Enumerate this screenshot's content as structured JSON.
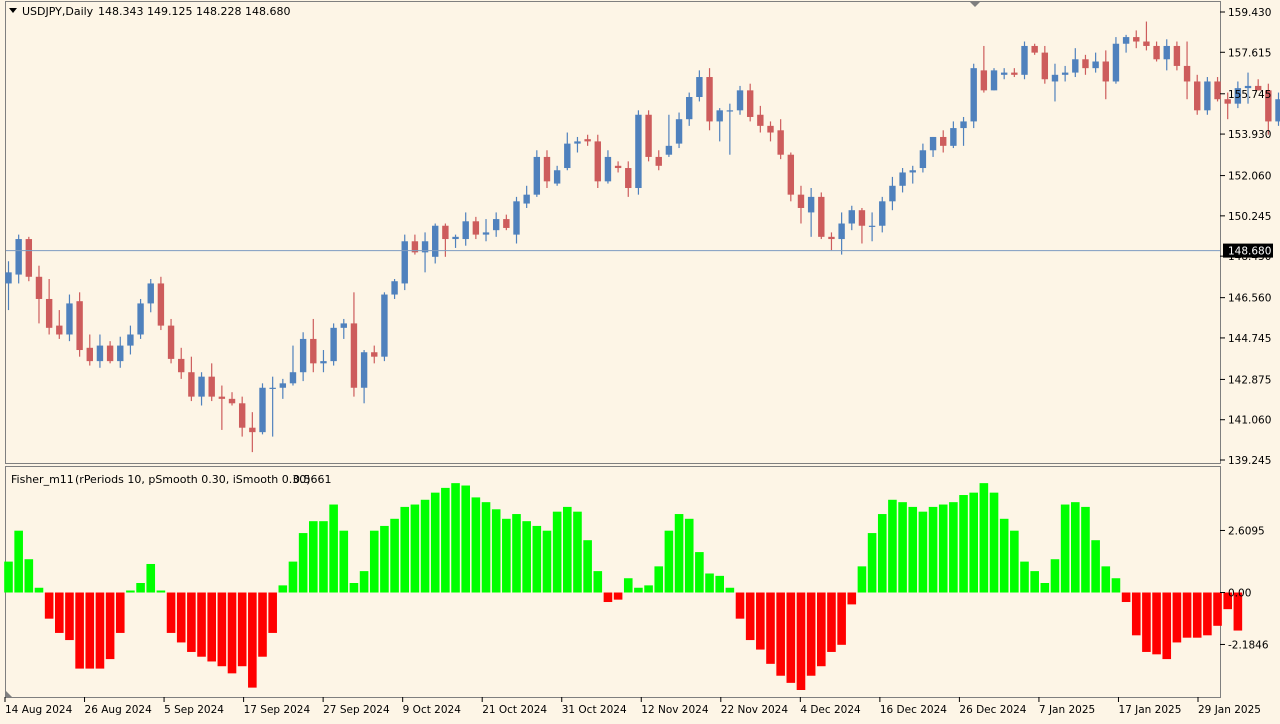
{
  "colors": {
    "background": "#fdf5e6",
    "frame": "#7f7f7f",
    "bull": "#4f81bd",
    "bear": "#cd5c5c",
    "hist_pos": "#00ff00",
    "hist_neg": "#ff0000",
    "price_line": "#7d9bc1",
    "text": "#000000"
  },
  "symbol_info": {
    "symbol_tf": "USDJPY,Daily",
    "ohlc": "148.343 149.125 148.228 148.680"
  },
  "indicator_info": {
    "name": "Fisher_m11",
    "params": "(rPeriods 10, pSmooth 0.30, iSmooth 0.30)",
    "value": "0.5661"
  },
  "price_labels": [
    "159.430",
    "157.615",
    "155.745",
    "153.930",
    "152.060",
    "150.245",
    "148.430",
    "146.560",
    "144.745",
    "142.875",
    "141.060",
    "139.245"
  ],
  "indicator_labels": [
    "2.6095",
    "0.00",
    "-2.1846"
  ],
  "current_price_label": "148.680",
  "date_labels": [
    "14 Aug 2024",
    "26 Aug 2024",
    "5 Sep 2024",
    "17 Sep 2024",
    "27 Sep 2024",
    "9 Oct 2024",
    "21 Oct 2024",
    "31 Oct 2024",
    "12 Nov 2024",
    "22 Nov 2024",
    "4 Dec 2024",
    "16 Dec 2024",
    "26 Dec 2024",
    "7 Jan 2025",
    "17 Jan 2025",
    "29 Jan 2025"
  ],
  "chart_data": [
    {
      "type": "candlestick",
      "title": "USDJPY,Daily",
      "ylim": [
        139.245,
        159.43
      ],
      "current_price": 148.68,
      "candles": [
        {
          "o": 147.2,
          "h": 148.2,
          "l": 146.0,
          "c": 147.7
        },
        {
          "o": 147.6,
          "h": 149.4,
          "l": 147.2,
          "c": 149.2
        },
        {
          "o": 149.2,
          "h": 149.3,
          "l": 147.3,
          "c": 147.5
        },
        {
          "o": 147.5,
          "h": 148.0,
          "l": 145.4,
          "c": 146.5
        },
        {
          "o": 146.5,
          "h": 147.4,
          "l": 144.9,
          "c": 145.2
        },
        {
          "o": 145.3,
          "h": 146.0,
          "l": 144.7,
          "c": 144.9
        },
        {
          "o": 144.9,
          "h": 146.7,
          "l": 144.6,
          "c": 146.3
        },
        {
          "o": 146.4,
          "h": 146.8,
          "l": 143.9,
          "c": 144.2
        },
        {
          "o": 144.3,
          "h": 144.9,
          "l": 143.5,
          "c": 143.7
        },
        {
          "o": 143.7,
          "h": 144.9,
          "l": 143.4,
          "c": 144.4
        },
        {
          "o": 144.4,
          "h": 144.6,
          "l": 143.6,
          "c": 143.7
        },
        {
          "o": 143.7,
          "h": 144.8,
          "l": 143.4,
          "c": 144.4
        },
        {
          "o": 144.4,
          "h": 145.3,
          "l": 144.0,
          "c": 144.9
        },
        {
          "o": 144.9,
          "h": 146.5,
          "l": 144.7,
          "c": 146.3
        },
        {
          "o": 146.3,
          "h": 147.4,
          "l": 145.9,
          "c": 147.2
        },
        {
          "o": 147.2,
          "h": 147.5,
          "l": 145.1,
          "c": 145.3
        },
        {
          "o": 145.3,
          "h": 145.6,
          "l": 143.6,
          "c": 143.8
        },
        {
          "o": 143.8,
          "h": 144.3,
          "l": 142.9,
          "c": 143.2
        },
        {
          "o": 143.2,
          "h": 143.9,
          "l": 141.9,
          "c": 142.1
        },
        {
          "o": 142.1,
          "h": 143.2,
          "l": 141.7,
          "c": 143.0
        },
        {
          "o": 143.0,
          "h": 143.6,
          "l": 141.9,
          "c": 142.1
        },
        {
          "o": 142.1,
          "h": 142.6,
          "l": 140.6,
          "c": 142.0
        },
        {
          "o": 142.0,
          "h": 142.3,
          "l": 141.7,
          "c": 141.8
        },
        {
          "o": 141.8,
          "h": 142.1,
          "l": 140.3,
          "c": 140.7
        },
        {
          "o": 140.7,
          "h": 141.4,
          "l": 139.6,
          "c": 140.5
        },
        {
          "o": 140.5,
          "h": 142.7,
          "l": 140.4,
          "c": 142.5
        },
        {
          "o": 142.5,
          "h": 143.0,
          "l": 140.3,
          "c": 142.5
        },
        {
          "o": 142.5,
          "h": 142.9,
          "l": 142.0,
          "c": 142.7
        },
        {
          "o": 142.7,
          "h": 144.4,
          "l": 142.6,
          "c": 143.2
        },
        {
          "o": 143.2,
          "h": 145.0,
          "l": 142.8,
          "c": 144.7
        },
        {
          "o": 144.7,
          "h": 145.6,
          "l": 143.2,
          "c": 143.6
        },
        {
          "o": 143.6,
          "h": 144.2,
          "l": 143.2,
          "c": 143.7
        },
        {
          "o": 143.7,
          "h": 145.4,
          "l": 143.5,
          "c": 145.2
        },
        {
          "o": 145.2,
          "h": 145.6,
          "l": 144.7,
          "c": 145.4
        },
        {
          "o": 145.4,
          "h": 146.8,
          "l": 142.1,
          "c": 142.5
        },
        {
          "o": 142.5,
          "h": 144.2,
          "l": 141.8,
          "c": 144.1
        },
        {
          "o": 144.1,
          "h": 144.4,
          "l": 143.6,
          "c": 143.9
        },
        {
          "o": 143.9,
          "h": 146.8,
          "l": 143.7,
          "c": 146.7
        },
        {
          "o": 146.7,
          "h": 147.4,
          "l": 146.5,
          "c": 147.3
        },
        {
          "o": 147.2,
          "h": 149.4,
          "l": 146.9,
          "c": 149.1
        },
        {
          "o": 149.1,
          "h": 149.4,
          "l": 148.5,
          "c": 148.6
        },
        {
          "o": 148.6,
          "h": 149.5,
          "l": 147.7,
          "c": 149.1
        },
        {
          "o": 148.4,
          "h": 149.9,
          "l": 148.1,
          "c": 149.8
        },
        {
          "o": 149.8,
          "h": 149.9,
          "l": 148.4,
          "c": 149.2
        },
        {
          "o": 149.2,
          "h": 149.4,
          "l": 148.8,
          "c": 149.3
        },
        {
          "o": 149.2,
          "h": 150.4,
          "l": 148.9,
          "c": 150.0
        },
        {
          "o": 150.0,
          "h": 150.2,
          "l": 149.2,
          "c": 149.4
        },
        {
          "o": 149.4,
          "h": 150.1,
          "l": 149.1,
          "c": 149.5
        },
        {
          "o": 149.6,
          "h": 150.4,
          "l": 149.3,
          "c": 150.1
        },
        {
          "o": 150.1,
          "h": 150.3,
          "l": 149.6,
          "c": 149.7
        },
        {
          "o": 149.4,
          "h": 151.1,
          "l": 149.0,
          "c": 150.9
        },
        {
          "o": 150.8,
          "h": 151.6,
          "l": 150.6,
          "c": 151.2
        },
        {
          "o": 151.2,
          "h": 153.2,
          "l": 151.1,
          "c": 152.9
        },
        {
          "o": 152.9,
          "h": 153.2,
          "l": 151.5,
          "c": 151.8
        },
        {
          "o": 151.7,
          "h": 152.5,
          "l": 151.6,
          "c": 152.3
        },
        {
          "o": 152.4,
          "h": 154.0,
          "l": 152.3,
          "c": 153.5
        },
        {
          "o": 153.5,
          "h": 153.8,
          "l": 153.1,
          "c": 153.6
        },
        {
          "o": 153.7,
          "h": 153.9,
          "l": 153.4,
          "c": 153.6
        },
        {
          "o": 153.6,
          "h": 153.9,
          "l": 151.5,
          "c": 151.8
        },
        {
          "o": 151.8,
          "h": 153.2,
          "l": 151.7,
          "c": 152.9
        },
        {
          "o": 152.5,
          "h": 152.7,
          "l": 152.2,
          "c": 152.4
        },
        {
          "o": 152.4,
          "h": 152.7,
          "l": 151.1,
          "c": 151.5
        },
        {
          "o": 151.5,
          "h": 155.0,
          "l": 151.2,
          "c": 154.8
        },
        {
          "o": 154.8,
          "h": 155.0,
          "l": 152.7,
          "c": 152.9
        },
        {
          "o": 152.9,
          "h": 153.2,
          "l": 152.3,
          "c": 152.5
        },
        {
          "o": 153.0,
          "h": 154.8,
          "l": 152.9,
          "c": 153.4
        },
        {
          "o": 153.5,
          "h": 154.9,
          "l": 153.3,
          "c": 154.6
        },
        {
          "o": 154.6,
          "h": 155.8,
          "l": 154.3,
          "c": 155.6
        },
        {
          "o": 155.6,
          "h": 156.8,
          "l": 155.4,
          "c": 156.5
        },
        {
          "o": 156.5,
          "h": 156.9,
          "l": 154.1,
          "c": 154.5
        },
        {
          "o": 154.5,
          "h": 155.1,
          "l": 153.6,
          "c": 155.0
        },
        {
          "o": 155.0,
          "h": 155.3,
          "l": 153.0,
          "c": 155.0
        },
        {
          "o": 155.0,
          "h": 156.1,
          "l": 154.8,
          "c": 155.9
        },
        {
          "o": 155.9,
          "h": 156.2,
          "l": 154.5,
          "c": 154.7
        },
        {
          "o": 154.8,
          "h": 155.2,
          "l": 154.0,
          "c": 154.3
        },
        {
          "o": 154.3,
          "h": 154.5,
          "l": 153.6,
          "c": 154.0
        },
        {
          "o": 154.1,
          "h": 154.6,
          "l": 152.8,
          "c": 153.0
        },
        {
          "o": 153.0,
          "h": 153.1,
          "l": 150.9,
          "c": 151.2
        },
        {
          "o": 151.2,
          "h": 151.6,
          "l": 149.9,
          "c": 150.6
        },
        {
          "o": 150.4,
          "h": 151.5,
          "l": 149.3,
          "c": 151.1
        },
        {
          "o": 151.1,
          "h": 151.3,
          "l": 149.2,
          "c": 149.3
        },
        {
          "o": 149.3,
          "h": 149.5,
          "l": 148.7,
          "c": 149.2
        },
        {
          "o": 149.2,
          "h": 150.4,
          "l": 148.5,
          "c": 149.9
        },
        {
          "o": 149.9,
          "h": 150.7,
          "l": 149.6,
          "c": 150.5
        },
        {
          "o": 150.5,
          "h": 150.6,
          "l": 149.0,
          "c": 149.8
        },
        {
          "o": 149.8,
          "h": 150.4,
          "l": 149.1,
          "c": 149.8
        },
        {
          "o": 149.8,
          "h": 151.1,
          "l": 149.5,
          "c": 150.9
        },
        {
          "o": 150.9,
          "h": 152.0,
          "l": 150.5,
          "c": 151.6
        },
        {
          "o": 151.6,
          "h": 152.4,
          "l": 151.3,
          "c": 152.2
        },
        {
          "o": 152.2,
          "h": 152.5,
          "l": 151.7,
          "c": 152.3
        },
        {
          "o": 152.4,
          "h": 153.5,
          "l": 152.2,
          "c": 153.2
        },
        {
          "o": 153.2,
          "h": 153.8,
          "l": 152.9,
          "c": 153.8
        },
        {
          "o": 153.8,
          "h": 154.1,
          "l": 153.1,
          "c": 153.4
        },
        {
          "o": 153.4,
          "h": 154.5,
          "l": 153.3,
          "c": 154.2
        },
        {
          "o": 154.2,
          "h": 154.7,
          "l": 153.4,
          "c": 154.5
        },
        {
          "o": 154.5,
          "h": 157.1,
          "l": 154.2,
          "c": 156.9
        },
        {
          "o": 156.8,
          "h": 157.9,
          "l": 155.8,
          "c": 155.9
        },
        {
          "o": 155.9,
          "h": 156.9,
          "l": 155.9,
          "c": 156.8
        },
        {
          "o": 156.6,
          "h": 156.9,
          "l": 156.4,
          "c": 156.7
        },
        {
          "o": 156.7,
          "h": 156.9,
          "l": 156.5,
          "c": 156.6
        },
        {
          "o": 156.6,
          "h": 158.1,
          "l": 156.4,
          "c": 157.9
        },
        {
          "o": 157.9,
          "h": 158.0,
          "l": 157.5,
          "c": 157.6
        },
        {
          "o": 157.6,
          "h": 157.9,
          "l": 156.2,
          "c": 156.4
        },
        {
          "o": 156.3,
          "h": 157.1,
          "l": 155.4,
          "c": 156.6
        },
        {
          "o": 156.6,
          "h": 157.0,
          "l": 156.3,
          "c": 156.7
        },
        {
          "o": 156.7,
          "h": 157.8,
          "l": 156.5,
          "c": 157.3
        },
        {
          "o": 157.3,
          "h": 157.5,
          "l": 156.6,
          "c": 156.9
        },
        {
          "o": 156.9,
          "h": 157.6,
          "l": 156.7,
          "c": 157.2
        },
        {
          "o": 157.2,
          "h": 157.7,
          "l": 155.5,
          "c": 156.3
        },
        {
          "o": 156.3,
          "h": 158.3,
          "l": 156.2,
          "c": 158.0
        },
        {
          "o": 158.0,
          "h": 158.4,
          "l": 157.6,
          "c": 158.3
        },
        {
          "o": 158.3,
          "h": 158.6,
          "l": 157.8,
          "c": 158.1
        },
        {
          "o": 158.1,
          "h": 159.0,
          "l": 157.7,
          "c": 157.9
        },
        {
          "o": 157.9,
          "h": 158.1,
          "l": 157.2,
          "c": 157.3
        },
        {
          "o": 157.3,
          "h": 158.2,
          "l": 156.8,
          "c": 157.9
        },
        {
          "o": 157.9,
          "h": 158.1,
          "l": 156.8,
          "c": 157.0
        },
        {
          "o": 157.0,
          "h": 158.1,
          "l": 155.5,
          "c": 156.3
        },
        {
          "o": 156.3,
          "h": 156.6,
          "l": 154.8,
          "c": 155.0
        },
        {
          "o": 155.0,
          "h": 156.5,
          "l": 154.8,
          "c": 156.3
        },
        {
          "o": 156.3,
          "h": 156.5,
          "l": 155.4,
          "c": 155.5
        },
        {
          "o": 155.5,
          "h": 155.8,
          "l": 154.6,
          "c": 155.3
        },
        {
          "o": 155.3,
          "h": 156.3,
          "l": 155.1,
          "c": 156.0
        },
        {
          "o": 156.0,
          "h": 156.7,
          "l": 155.3,
          "c": 156.1
        },
        {
          "o": 156.1,
          "h": 156.4,
          "l": 155.9,
          "c": 155.9
        },
        {
          "o": 155.9,
          "h": 156.2,
          "l": 153.9,
          "c": 154.5
        },
        {
          "o": 154.5,
          "h": 155.8,
          "l": 154.3,
          "c": 155.5
        },
        {
          "o": 155.5,
          "h": 155.9,
          "l": 154.9,
          "c": 155.1
        },
        {
          "o": 155.1,
          "h": 155.3,
          "l": 153.8,
          "c": 154.4
        },
        {
          "o": 154.3,
          "h": 155.4,
          "l": 154.0,
          "c": 155.3
        }
      ]
    },
    {
      "type": "bar",
      "title": "Fisher_m11",
      "ylim": [
        -2.1846,
        2.6095
      ],
      "values": [
        1.3,
        2.6,
        1.4,
        0.2,
        -1.1,
        -1.7,
        -2.0,
        -3.2,
        -3.2,
        -3.2,
        -2.8,
        -1.7,
        0.0,
        0.4,
        1.2,
        0.0,
        -1.7,
        -2.1,
        -2.5,
        -2.7,
        -2.9,
        -3.1,
        -3.4,
        -3.1,
        -4.0,
        -2.7,
        -1.7,
        0.3,
        1.3,
        2.5,
        3.0,
        3.0,
        3.7,
        2.6,
        0.4,
        0.9,
        2.6,
        2.8,
        3.1,
        3.6,
        3.7,
        3.9,
        4.2,
        4.4,
        4.6,
        4.5,
        4.0,
        3.8,
        3.5,
        3.1,
        3.3,
        3.0,
        2.8,
        2.6,
        3.4,
        3.6,
        3.4,
        2.2,
        0.9,
        -0.4,
        -0.3,
        0.6,
        0.2,
        0.3,
        1.1,
        2.6,
        3.3,
        3.1,
        1.7,
        0.8,
        0.7,
        0.2,
        -1.1,
        -2.0,
        -2.4,
        -3.0,
        -3.5,
        -3.8,
        -4.1,
        -3.5,
        -3.1,
        -2.5,
        -2.2,
        -0.5,
        1.1,
        2.5,
        3.3,
        3.9,
        3.8,
        3.6,
        3.4,
        3.6,
        3.7,
        3.8,
        4.1,
        4.2,
        4.6,
        4.2,
        3.1,
        2.6,
        1.3,
        0.9,
        0.4,
        1.4,
        3.7,
        3.8,
        3.6,
        2.2,
        1.1,
        0.6,
        -0.4,
        -1.8,
        -2.5,
        -2.6,
        -2.8,
        -2.1,
        -1.9,
        -1.9,
        -1.8,
        -1.4,
        -0.7,
        -1.6
      ]
    }
  ]
}
